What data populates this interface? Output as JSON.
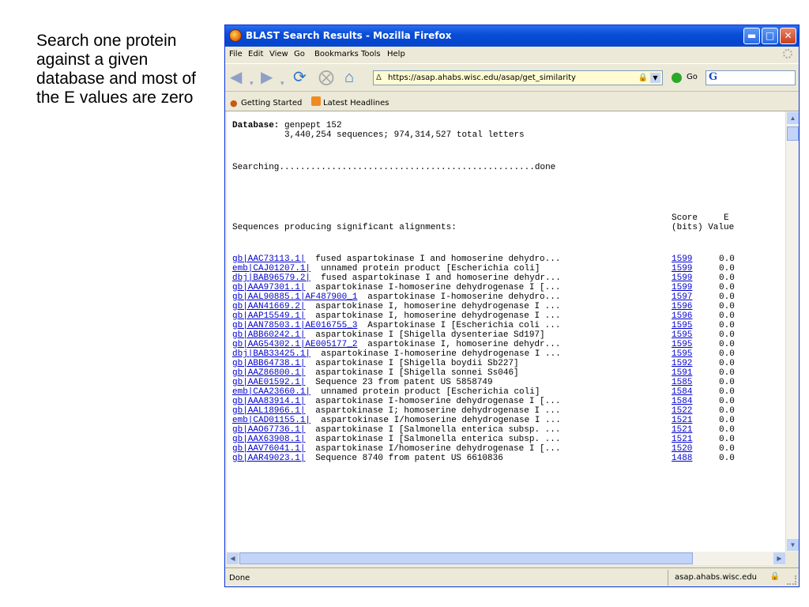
{
  "caption": "Search one protein against a given database and most of the E values are zero",
  "window": {
    "title": "BLAST Search Results - Mozilla Firefox"
  },
  "menu": {
    "items": [
      "File",
      "Edit",
      "View",
      "Go",
      "Bookmarks",
      "Tools",
      "Help"
    ]
  },
  "nav": {
    "url": "https://asap.ahabs.wisc.edu/asap/get_similarity",
    "go_label": "Go"
  },
  "bookmarks": {
    "items": [
      "Getting Started",
      "Latest Headlines"
    ]
  },
  "blast": {
    "database_label": "Database:",
    "database_name": " genpept 152",
    "stats": "          3,440,254 sequences; 974,314,527 total letters",
    "searching": "Searching.................................................done",
    "score_header_1": "Score     E",
    "score_header_2": "(bits) Value",
    "sequences_header": "Sequences producing significant alignments:",
    "rows": [
      {
        "id": "gb|AAC73113.1|",
        "desc": "  fused aspartokinase I and homoserine dehydro...",
        "score": "1599",
        "evalue": "0.0"
      },
      {
        "id": "emb|CAJ01207.1|",
        "desc": "  unnamed protein product [Escherichia coli]",
        "score": "1599",
        "evalue": "0.0"
      },
      {
        "id": "dbj|BAB96579.2|",
        "desc": "  fused aspartokinase I and homoserine dehydr...",
        "score": "1599",
        "evalue": "0.0"
      },
      {
        "id": "gb|AAA97301.1|",
        "desc": "  aspartokinase I-homoserine dehydrogenase I [...",
        "score": "1599",
        "evalue": "0.0"
      },
      {
        "id": "gb|AAL90885.1|AF487900_1",
        "desc": "  aspartokinase I-homoserine dehydro...",
        "score": "1597",
        "evalue": "0.0"
      },
      {
        "id": "gb|AAN41669.2|",
        "desc": "  aspartokinase I, homoserine dehydrogenase I ...",
        "score": "1596",
        "evalue": "0.0"
      },
      {
        "id": "gb|AAP15549.1|",
        "desc": "  aspartokinase I, homoserine dehydrogenase I ...",
        "score": "1596",
        "evalue": "0.0"
      },
      {
        "id": "gb|AAN78503.1|AE016755_3",
        "desc": "  Aspartokinase I [Escherichia coli ...",
        "score": "1595",
        "evalue": "0.0"
      },
      {
        "id": "gb|ABB60242.1|",
        "desc": "  aspartokinase I [Shigella dysenteriae Sd197]",
        "score": "1595",
        "evalue": "0.0"
      },
      {
        "id": "gb|AAG54302.1|AE005177_2",
        "desc": "  aspartokinase I, homoserine dehydr...",
        "score": "1595",
        "evalue": "0.0"
      },
      {
        "id": "dbj|BAB33425.1|",
        "desc": "  aspartokinase I-homoserine dehydrogenase I ...",
        "score": "1595",
        "evalue": "0.0"
      },
      {
        "id": "gb|ABB64738.1|",
        "desc": "  aspartokinase I [Shigella boydii Sb227]",
        "score": "1592",
        "evalue": "0.0"
      },
      {
        "id": "gb|AAZ86800.1|",
        "desc": "  aspartokinase I [Shigella sonnei Ss046]",
        "score": "1591",
        "evalue": "0.0"
      },
      {
        "id": "gb|AAE01592.1|",
        "desc": "  Sequence 23 from patent US 5858749",
        "score": "1585",
        "evalue": "0.0"
      },
      {
        "id": "emb|CAA23660.1|",
        "desc": "  unnamed protein product [Escherichia coli]",
        "score": "1584",
        "evalue": "0.0"
      },
      {
        "id": "gb|AAA83914.1|",
        "desc": "  aspartokinase I-homoserine dehydrogenase I [...",
        "score": "1584",
        "evalue": "0.0"
      },
      {
        "id": "gb|AAL18966.1|",
        "desc": "  aspartokinase I; homoserine dehydrogenase I ...",
        "score": "1522",
        "evalue": "0.0"
      },
      {
        "id": "emb|CAD01155.1|",
        "desc": "  aspartokinase I/homoserine dehydrogenase I ...",
        "score": "1521",
        "evalue": "0.0"
      },
      {
        "id": "gb|AAO67736.1|",
        "desc": "  aspartokinase I [Salmonella enterica subsp. ...",
        "score": "1521",
        "evalue": "0.0"
      },
      {
        "id": "gb|AAX63908.1|",
        "desc": "  aspartokinase I [Salmonella enterica subsp. ...",
        "score": "1521",
        "evalue": "0.0"
      },
      {
        "id": "gb|AAV76041.1|",
        "desc": "  aspartokinase I/homoserine dehydrogenase I [...",
        "score": "1520",
        "evalue": "0.0"
      },
      {
        "id": "gb|AAR49023.1|",
        "desc": "  Sequence 8740 from patent US 6610836",
        "score": "1488",
        "evalue": "0.0"
      }
    ]
  },
  "status": {
    "text": "Done",
    "host": "asap.ahabs.wisc.edu"
  },
  "colors": {
    "titlebar": "#0a4fd6",
    "link": "#0000cc",
    "chrome": "#ece9d8"
  }
}
